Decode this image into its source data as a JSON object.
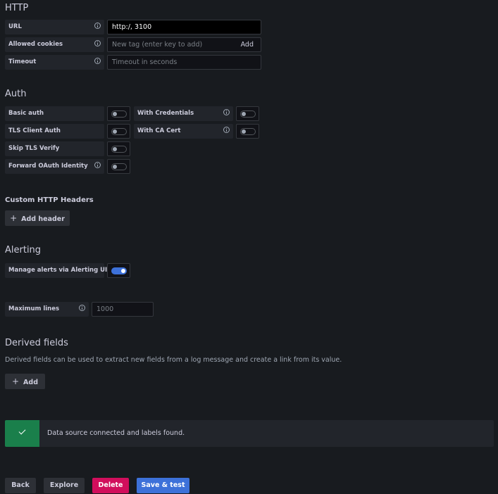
{
  "http": {
    "title": "HTTP",
    "url": {
      "label": "URL",
      "value": "http:/,            3100"
    },
    "allowed_cookies": {
      "label": "Allowed cookies",
      "placeholder": "New tag (enter key to add)",
      "add_label": "Add"
    },
    "timeout": {
      "label": "Timeout",
      "placeholder": "Timeout in seconds"
    }
  },
  "auth": {
    "title": "Auth",
    "basic_auth": {
      "label": "Basic auth",
      "enabled": false
    },
    "with_credentials": {
      "label": "With Credentials",
      "enabled": false
    },
    "tls_client_auth": {
      "label": "TLS Client Auth",
      "enabled": false
    },
    "with_ca_cert": {
      "label": "With CA Cert",
      "enabled": false
    },
    "skip_tls_verify": {
      "label": "Skip TLS Verify",
      "enabled": false
    },
    "forward_oauth": {
      "label": "Forward OAuth Identity",
      "enabled": false
    }
  },
  "custom_headers": {
    "title": "Custom HTTP Headers",
    "add_label": "Add header"
  },
  "alerting": {
    "title": "Alerting",
    "manage_alerts": {
      "label": "Manage alerts via Alerting UI",
      "enabled": true
    }
  },
  "max_lines": {
    "label": "Maximum lines",
    "placeholder": "1000"
  },
  "derived_fields": {
    "title": "Derived fields",
    "description": "Derived fields can be used to extract new fields from a log message and create a link from its value.",
    "add_label": "Add"
  },
  "alert": {
    "message": "Data source connected and labels found.",
    "status_color": "#1a7f4b"
  },
  "footer": {
    "back_label": "Back",
    "explore_label": "Explore",
    "delete_label": "Delete",
    "save_label": "Save & test"
  },
  "colors": {
    "background": "#181b1f",
    "primary": "#3d71d9",
    "danger": "#d10e5c",
    "success": "#1a7f4b"
  }
}
